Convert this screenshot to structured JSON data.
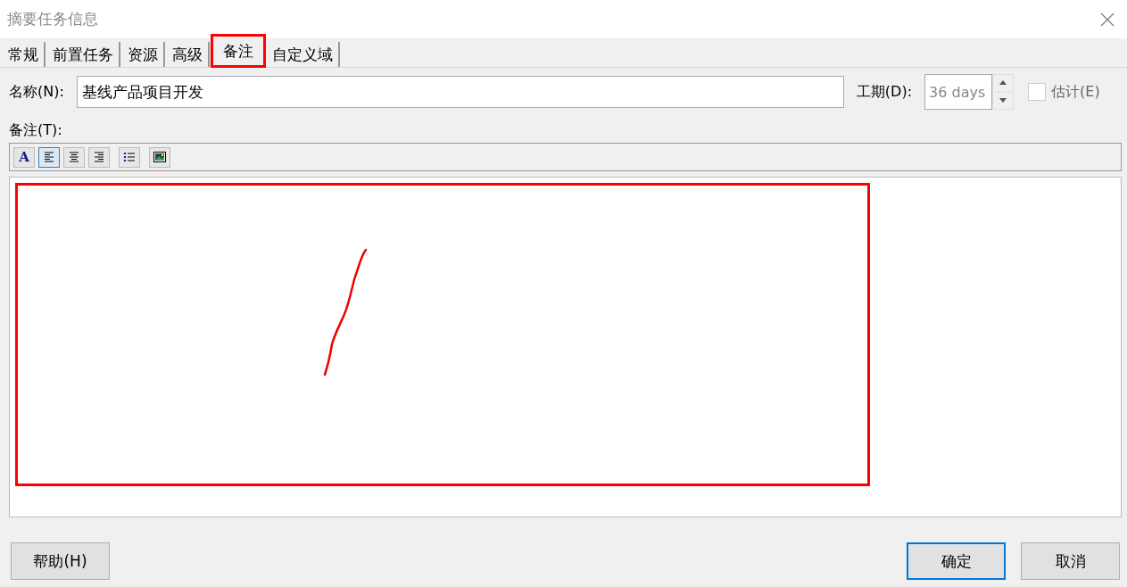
{
  "window": {
    "title": "摘要任务信息"
  },
  "tabs": [
    {
      "label": "常规",
      "selected": false,
      "highlighted": false
    },
    {
      "label": "前置任务",
      "selected": false,
      "highlighted": false
    },
    {
      "label": "资源",
      "selected": false,
      "highlighted": false
    },
    {
      "label": "高级",
      "selected": false,
      "highlighted": false
    },
    {
      "label": "备注",
      "selected": true,
      "highlighted": true
    },
    {
      "label": "自定义域",
      "selected": false,
      "highlighted": false
    }
  ],
  "name": {
    "label": "名称(N):",
    "value": "基线产品项目开发"
  },
  "duration": {
    "label": "工期(D):",
    "value": "36 days",
    "disabled": true
  },
  "estimated": {
    "label": "估计(E)",
    "checked": false,
    "disabled": true
  },
  "notes": {
    "label": "备注(T):",
    "highlighted": true
  },
  "toolbar": [
    {
      "kind": "font",
      "label": "A",
      "selected": false
    },
    {
      "kind": "align-left",
      "selected": true
    },
    {
      "kind": "align-center",
      "selected": false
    },
    {
      "kind": "align-right",
      "selected": false
    },
    {
      "kind": "bullets",
      "selected": false
    },
    {
      "kind": "image",
      "selected": false
    }
  ],
  "buttons": [
    {
      "label": "帮助(H)",
      "kind": "help",
      "default": false
    },
    {
      "label": "确定",
      "kind": "ok",
      "default": true
    },
    {
      "label": "取消",
      "kind": "cancel",
      "default": false
    }
  ]
}
